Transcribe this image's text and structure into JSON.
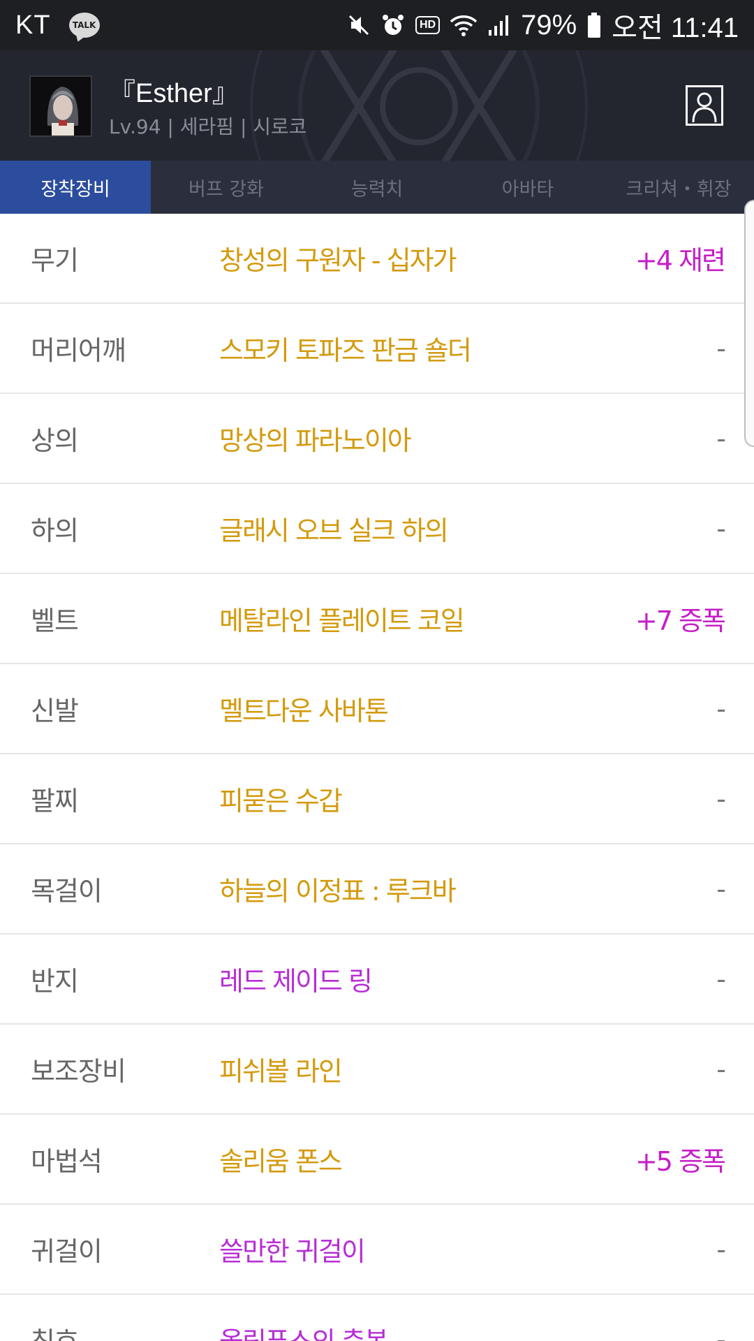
{
  "status_bar": {
    "carrier": "KT",
    "talk_badge": "TALK",
    "hd_badge": "HD",
    "battery": "79%",
    "time": "오전 11:41",
    "icons": [
      "mute-icon",
      "alarm-icon",
      "hd-icon",
      "wifi-icon",
      "signal-icon",
      "battery-icon"
    ]
  },
  "header": {
    "character_name": "『Esther』",
    "character_info": "Lv.94 | 세라핌 | 시로코",
    "profile_icon": "person-icon"
  },
  "tabs": [
    {
      "label": "장착장비",
      "active": true
    },
    {
      "label": "버프 강화",
      "active": false
    },
    {
      "label": "능력치",
      "active": false
    },
    {
      "label": "아바타",
      "active": false
    },
    {
      "label": "크리쳐・휘장",
      "active": false
    }
  ],
  "equipment": [
    {
      "slot": "무기",
      "item": "창성의 구원자 - 십자가",
      "rarity": "gold",
      "enhance": "+4 재련"
    },
    {
      "slot": "머리어깨",
      "item": "스모키 토파즈 판금 숄더",
      "rarity": "gold",
      "enhance": "-"
    },
    {
      "slot": "상의",
      "item": "망상의 파라노이아",
      "rarity": "gold",
      "enhance": "-"
    },
    {
      "slot": "하의",
      "item": "글래시 오브 실크 하의",
      "rarity": "gold",
      "enhance": "-"
    },
    {
      "slot": "벨트",
      "item": "메탈라인 플레이트 코일",
      "rarity": "gold",
      "enhance": "+7 증폭"
    },
    {
      "slot": "신발",
      "item": "멜트다운 사바톤",
      "rarity": "gold",
      "enhance": "-"
    },
    {
      "slot": "팔찌",
      "item": "피묻은 수갑",
      "rarity": "gold",
      "enhance": "-"
    },
    {
      "slot": "목걸이",
      "item": "하늘의 이정표 : 루크바",
      "rarity": "gold",
      "enhance": "-"
    },
    {
      "slot": "반지",
      "item": "레드 제이드 링",
      "rarity": "purple",
      "enhance": "-"
    },
    {
      "slot": "보조장비",
      "item": "피쉬볼 라인",
      "rarity": "gold",
      "enhance": "-"
    },
    {
      "slot": "마법석",
      "item": "솔리움 폰스",
      "rarity": "gold",
      "enhance": "+5 증폭"
    },
    {
      "slot": "귀걸이",
      "item": "쓸만한 귀걸이",
      "rarity": "purple",
      "enhance": "-"
    },
    {
      "slot": "칭호",
      "item": "올림푸스의 축복",
      "rarity": "purple",
      "enhance": "-"
    }
  ],
  "colors": {
    "status_bar_bg": "#1e1f23",
    "header_bg": "#23252f",
    "tab_bar_bg": "#2b2e3c",
    "tab_active_bg": "#2c4d9e",
    "item_gold": "#d39a0c",
    "item_purple": "#b72ed6",
    "enhance_magenta": "#c61ec8"
  }
}
